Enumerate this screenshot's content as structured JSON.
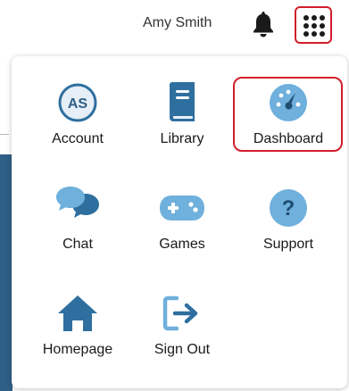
{
  "header": {
    "user_name": "Amy Smith"
  },
  "icons": {
    "bell": "bell-icon",
    "apps": "apps-grid-icon"
  },
  "colors": {
    "icon_blue": "#2f6f9f",
    "icon_light_blue": "#6fb0dc",
    "highlight_red": "#d11f2a",
    "avatar_bg": "#e6eef7",
    "avatar_text": "#2f5e86"
  },
  "menu": {
    "items": [
      {
        "label": "Account",
        "icon": "account-avatar-icon",
        "avatar_initials": "AS"
      },
      {
        "label": "Library",
        "icon": "library-book-icon"
      },
      {
        "label": "Dashboard",
        "icon": "dashboard-gauge-icon",
        "highlighted": true
      },
      {
        "label": "Chat",
        "icon": "chat-bubbles-icon"
      },
      {
        "label": "Games",
        "icon": "gamepad-icon"
      },
      {
        "label": "Support",
        "icon": "support-question-icon"
      },
      {
        "label": "Homepage",
        "icon": "home-icon"
      },
      {
        "label": "Sign Out",
        "icon": "sign-out-icon"
      }
    ]
  }
}
